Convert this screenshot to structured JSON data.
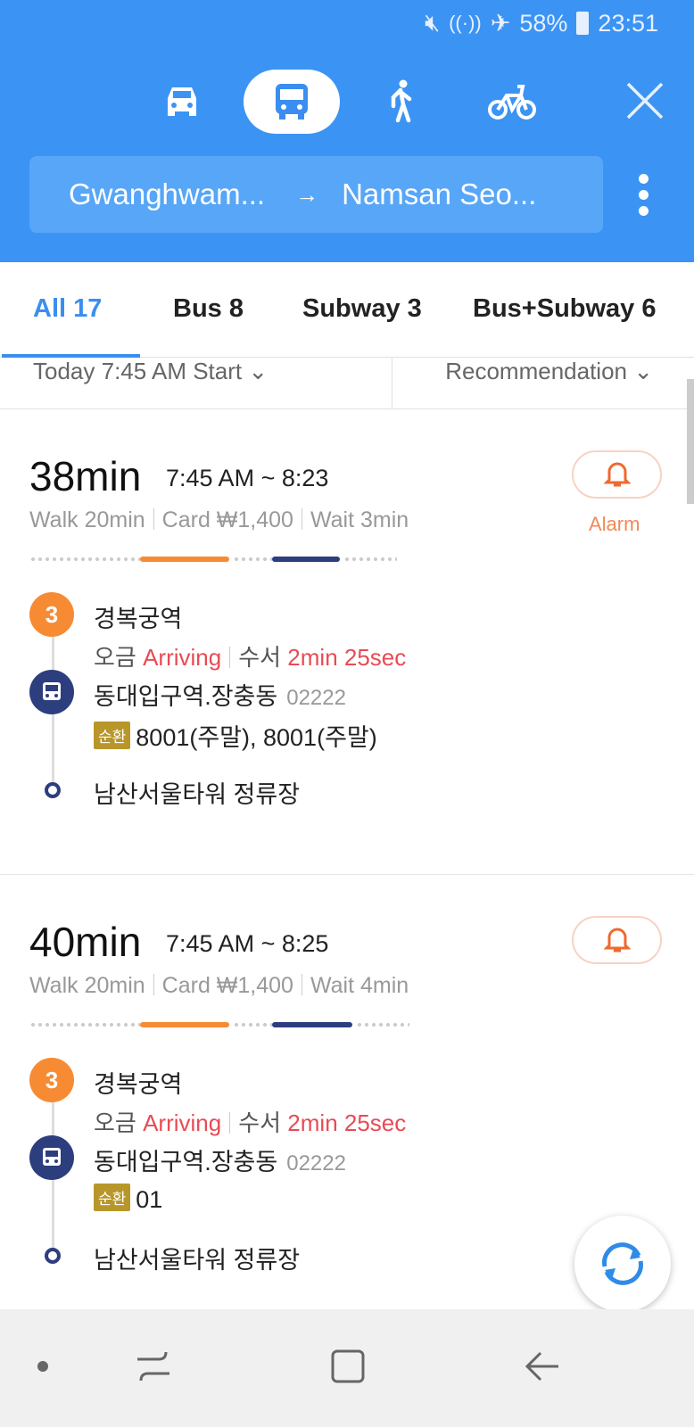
{
  "status_bar": {
    "battery": "58%",
    "time": "23:51",
    "icons": [
      "mute-icon",
      "wifi-icon",
      "airplane-icon",
      "battery-icon"
    ]
  },
  "modes": [
    {
      "name": "car",
      "active": false
    },
    {
      "name": "bus",
      "active": true
    },
    {
      "name": "walk",
      "active": false
    },
    {
      "name": "bike",
      "active": false
    }
  ],
  "route": {
    "from": "Gwanghwam...",
    "arrow": "→",
    "to": "Namsan Seo..."
  },
  "tabs": [
    {
      "label": "All 17",
      "active": true
    },
    {
      "label": "Bus 8"
    },
    {
      "label": "Subway 3"
    },
    {
      "label": "Bus+Subway 6"
    }
  ],
  "filters": {
    "time": "Today 7:45 AM Start ⌄",
    "sort": "Recommendation ⌄"
  },
  "routes": [
    {
      "duration": "38min",
      "times": "7:45 AM ~ 8:23",
      "walk": "Walk 20min",
      "card": "Card ₩1,400",
      "wait": "Wait 3min",
      "alarm": "Alarm",
      "colors": {
        "subway": "#f68b33",
        "bus": "#2d3e7e"
      },
      "steps": {
        "subway_line": "3",
        "station": "경복궁역",
        "dir1": "오금",
        "dir1_status": "Arriving",
        "dir2": "수서",
        "dir2_status": "2min 25sec",
        "bus_stop": "동대입구역.장충동",
        "bus_stop_id": "02222",
        "badge": "순환",
        "bus_lines": "8001(주말), 8001(주말)",
        "destination": "남산서울타워 정류장"
      }
    },
    {
      "duration": "40min",
      "times": "7:45 AM ~ 8:25",
      "walk": "Walk 20min",
      "card": "Card ₩1,400",
      "wait": "Wait 4min",
      "steps": {
        "subway_line": "3",
        "station": "경복궁역",
        "dir1": "오금",
        "dir1_status": "Arriving",
        "dir2": "수서",
        "dir2_status": "2min 25sec",
        "bus_stop": "동대입구역.장충동",
        "bus_stop_id": "02222",
        "badge": "순환",
        "bus_lines": "01",
        "destination": "남산서울타워 정류장"
      }
    }
  ]
}
